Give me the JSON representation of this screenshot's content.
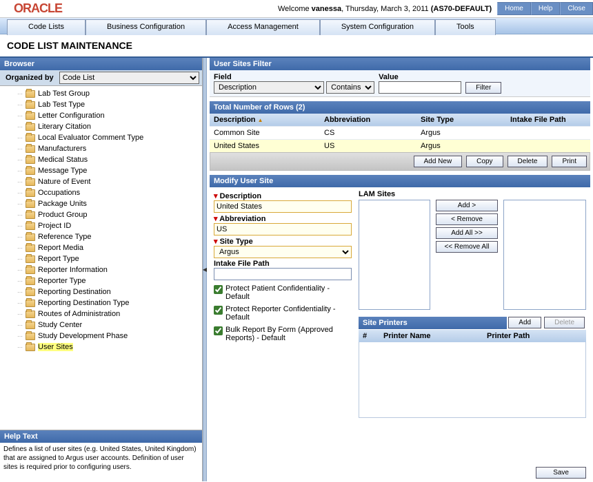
{
  "logo": "ORACLE",
  "welcome_prefix": "Welcome ",
  "welcome_user": "vanessa",
  "welcome_date": ", Thursday, March 3, 2011 ",
  "welcome_ctx": "(AS70-DEFAULT)",
  "top_btns": {
    "home": "Home",
    "help": "Help",
    "close": "Close"
  },
  "nav": [
    "Code Lists",
    "Business Configuration",
    "Access Management",
    "System Configuration",
    "Tools"
  ],
  "page_title": "CODE LIST MAINTENANCE",
  "browser": {
    "title": "Browser",
    "organized_label": "Organized by",
    "organized_value": "Code List",
    "items": [
      "Lab Test Group",
      "Lab Test Type",
      "Letter Configuration",
      "Literary Citation",
      "Local Evaluator Comment Type",
      "Manufacturers",
      "Medical Status",
      "Message Type",
      "Nature of Event",
      "Occupations",
      "Package Units",
      "Product Group",
      "Project ID",
      "Reference Type",
      "Report Media",
      "Report Type",
      "Reporter Information",
      "Reporter Type",
      "Reporting Destination",
      "Reporting Destination Type",
      "Routes of Administration",
      "Study Center",
      "Study Development Phase",
      "User Sites"
    ],
    "selected_index": 23
  },
  "help": {
    "title": "Help Text",
    "body": "Defines a list of user sites (e.g. United States, United Kingdom) that are assigned to Argus user accounts. Definition of user sites is required prior to configuring users."
  },
  "filter": {
    "title": "User Sites Filter",
    "field_label": "Field",
    "field_value": "Description",
    "op_value": "Contains",
    "value_label": "Value",
    "value_value": "",
    "btn": "Filter"
  },
  "grid": {
    "title": "Total Number of Rows (2)",
    "cols": [
      "Description",
      "Abbreviation",
      "Site Type",
      "Intake File Path"
    ],
    "rows": [
      {
        "desc": "Common Site",
        "abbr": "CS",
        "type": "Argus",
        "path": ""
      },
      {
        "desc": "United States",
        "abbr": "US",
        "type": "Argus",
        "path": ""
      }
    ],
    "selected_index": 1,
    "actions": {
      "add": "Add New",
      "copy": "Copy",
      "delete": "Delete",
      "print": "Print"
    }
  },
  "modify": {
    "title": "Modify User Site",
    "desc_label": "Description",
    "desc_value": "United States",
    "abbr_label": "Abbreviation",
    "abbr_value": "US",
    "type_label": "Site Type",
    "type_value": "Argus",
    "path_label": "Intake File Path",
    "path_value": "",
    "chk1": "Protect Patient Confidentiality - Default",
    "chk2": "Protect Reporter Confidentiality - Default",
    "chk3": "Bulk Report By Form (Approved Reports) - Default",
    "lam_label": "LAM Sites",
    "lam_btns": {
      "add": "Add >",
      "remove": "< Remove",
      "addall": "Add All >>",
      "removeall": "<< Remove All"
    }
  },
  "printers": {
    "title": "Site Printers",
    "add_btn": "Add",
    "del_btn": "Delete",
    "cols": {
      "n": "#",
      "name": "Printer Name",
      "path": "Printer Path"
    }
  },
  "save_btn": "Save"
}
